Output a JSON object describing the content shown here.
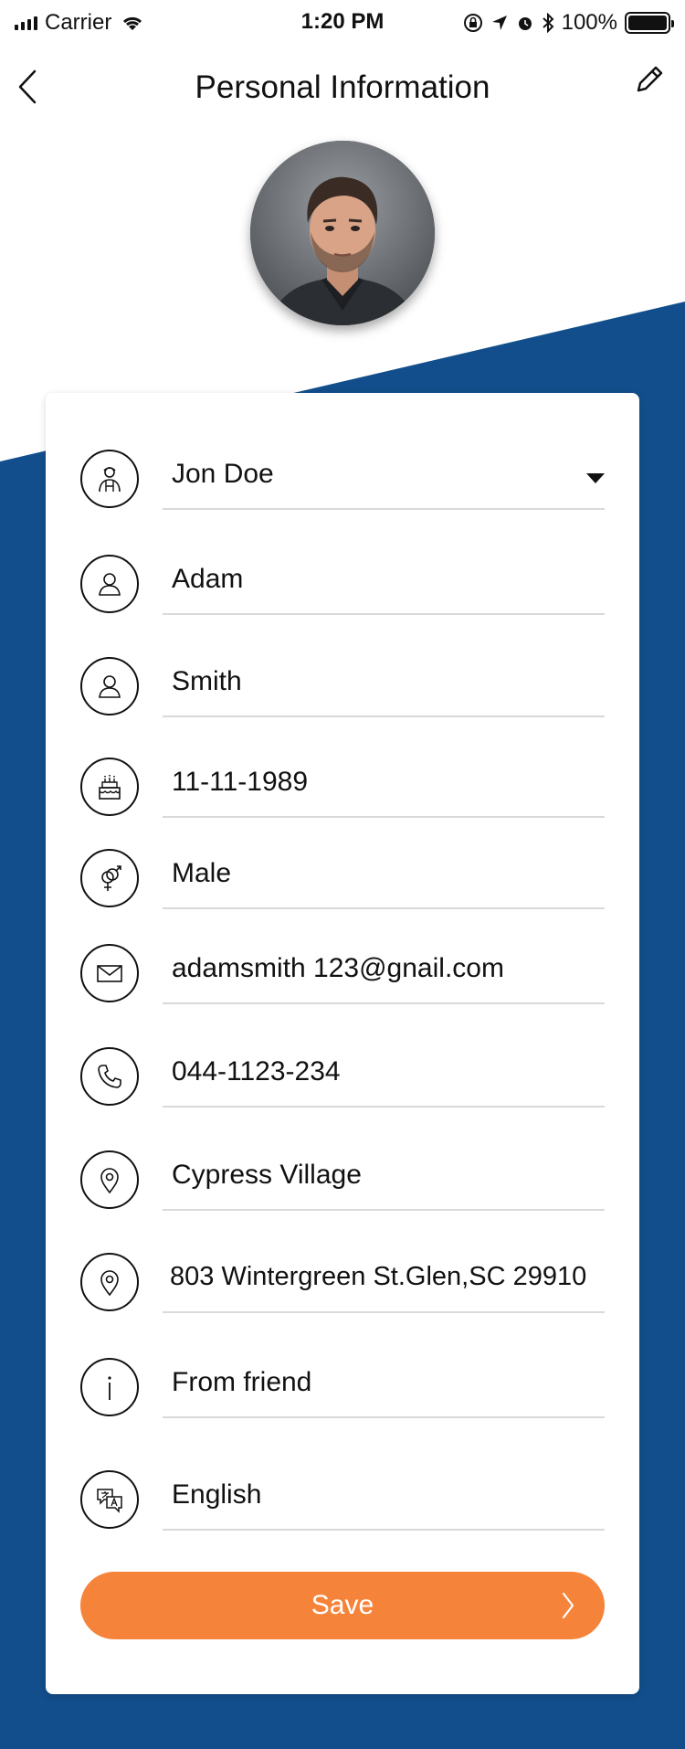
{
  "colors": {
    "accent": "#f5843a",
    "brand_blue": "#124e8b"
  },
  "status_bar": {
    "carrier": "Carrier",
    "time": "1:20 PM",
    "battery": "100%"
  },
  "header": {
    "title": "Personal Information",
    "back_icon": "chevron-left-icon",
    "edit_icon": "pencil-icon"
  },
  "profile": {
    "avatar_icon": "user-photo"
  },
  "fields": [
    {
      "name": "role",
      "icon": "worker-icon",
      "value": "Jon Doe",
      "dropdown": true
    },
    {
      "name": "first-name",
      "icon": "user-icon",
      "value": "Adam"
    },
    {
      "name": "last-name",
      "icon": "user-icon",
      "value": "Smith"
    },
    {
      "name": "birthday",
      "icon": "cake-icon",
      "value": "11-11-1989"
    },
    {
      "name": "gender",
      "icon": "gender-icon",
      "value": "Male"
    },
    {
      "name": "email",
      "icon": "envelope-icon",
      "value": "adamsmith 123@gnail.com"
    },
    {
      "name": "phone",
      "icon": "phone-icon",
      "value": " 044-1123-234"
    },
    {
      "name": "city",
      "icon": "location-pin-icon",
      "value": "Cypress Village"
    },
    {
      "name": "address",
      "icon": "location-pin-icon",
      "value": "803 Wintergreen St.Glen,SC 29910"
    },
    {
      "name": "referral",
      "icon": "info-icon",
      "value": "From friend"
    },
    {
      "name": "language",
      "icon": "translate-icon",
      "value": "English"
    }
  ],
  "save_button": {
    "label": "Save"
  }
}
